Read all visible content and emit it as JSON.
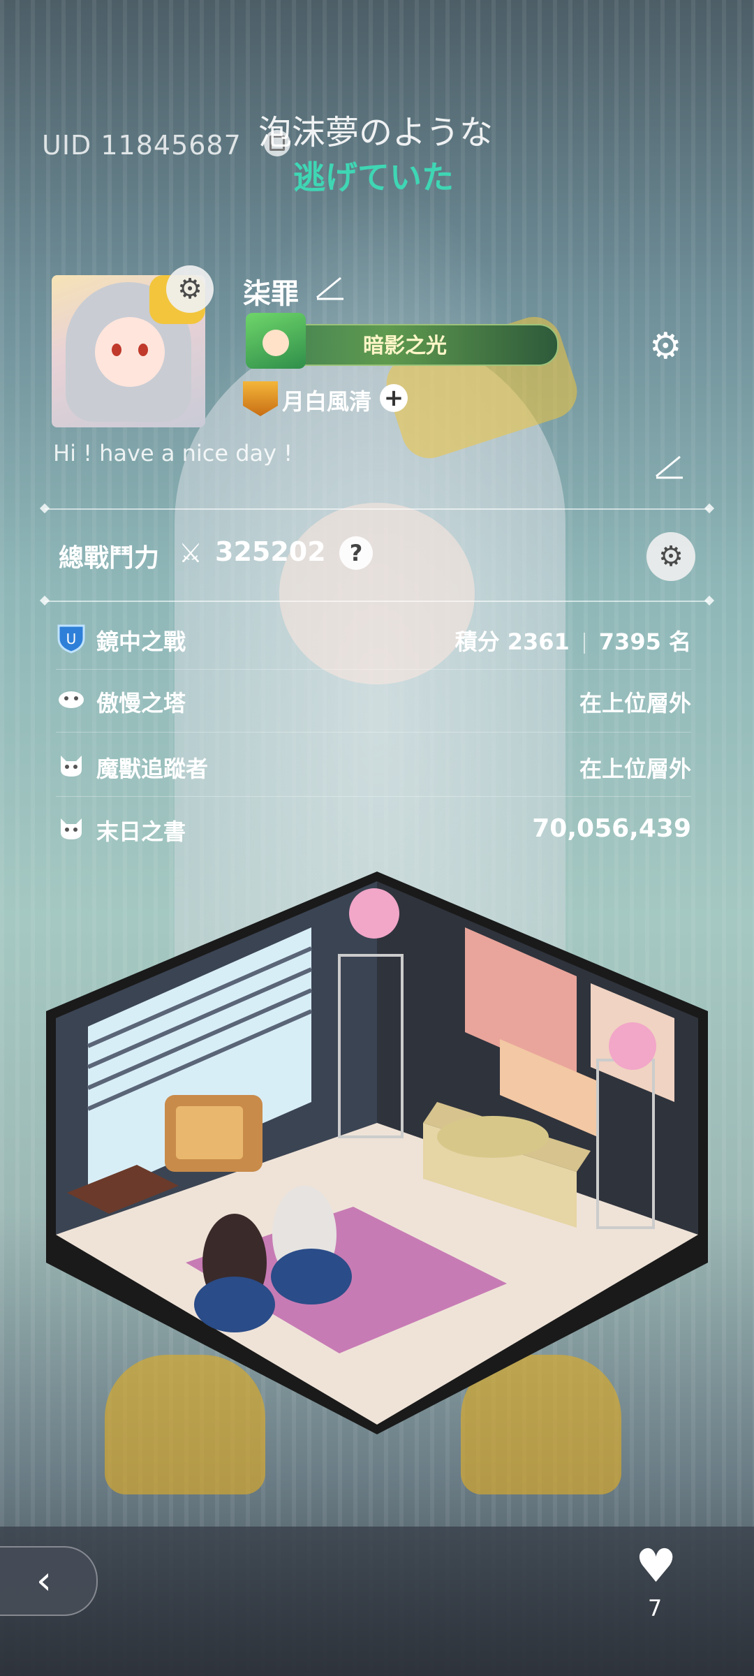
{
  "header": {
    "uid": "UID 11845687",
    "lyric_line1": "泡沫夢のような",
    "lyric_line2": "逃げていた"
  },
  "profile": {
    "username": "柒罪",
    "title_name": "暗影之光",
    "guild_name": "月白風清",
    "bio": "Hi ! have a nice day !"
  },
  "power": {
    "label": "總戰鬥力",
    "value": "325202",
    "help_icon": "?"
  },
  "stats": [
    {
      "label": "鏡中之戰",
      "value_left": "積分 2361",
      "value_right": "7395 名",
      "icon": "shield-trophy-icon"
    },
    {
      "label": "傲慢之塔",
      "value": "在上位層外",
      "icon": "tower-icon"
    },
    {
      "label": "魔獸追蹤者",
      "value": "在上位層外",
      "icon": "beast-icon"
    },
    {
      "label": "末日之書",
      "value": "70,056,439",
      "icon": "beast-icon"
    }
  ],
  "footer": {
    "like_count": "7"
  },
  "colors": {
    "lyric_accent": "#3fd6b4",
    "title_bar": "#5f9a4f",
    "guild_badge": "#f4b63a"
  }
}
